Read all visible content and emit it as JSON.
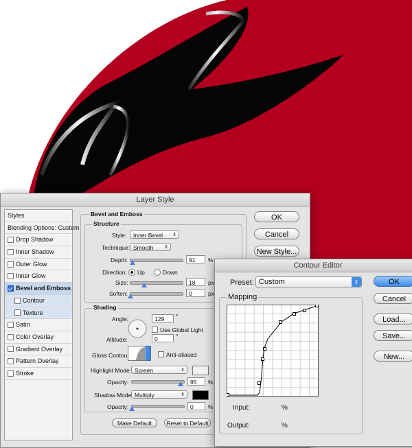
{
  "layer_style": {
    "title": "Layer Style",
    "styles_list": [
      {
        "label": "Styles",
        "checkbox": false,
        "checked": false,
        "kind": "head"
      },
      {
        "label": "Blending Options: Custom",
        "checkbox": false,
        "checked": false,
        "kind": "head"
      },
      {
        "label": "Drop Shadow",
        "checkbox": true,
        "checked": false,
        "kind": "item"
      },
      {
        "label": "Inner Shadow",
        "checkbox": true,
        "checked": false,
        "kind": "item"
      },
      {
        "label": "Outer Glow",
        "checkbox": true,
        "checked": false,
        "kind": "item"
      },
      {
        "label": "Inner Glow",
        "checkbox": true,
        "checked": false,
        "kind": "item"
      },
      {
        "label": "Bevel and Emboss",
        "checkbox": true,
        "checked": true,
        "kind": "sel"
      },
      {
        "label": "Contour",
        "checkbox": true,
        "checked": false,
        "kind": "sub"
      },
      {
        "label": "Texture",
        "checkbox": true,
        "checked": false,
        "kind": "sub"
      },
      {
        "label": "Satin",
        "checkbox": true,
        "checked": false,
        "kind": "item"
      },
      {
        "label": "Color Overlay",
        "checkbox": true,
        "checked": false,
        "kind": "item"
      },
      {
        "label": "Gradient Overlay",
        "checkbox": true,
        "checked": false,
        "kind": "item"
      },
      {
        "label": "Pattern Overlay",
        "checkbox": true,
        "checked": false,
        "kind": "item"
      },
      {
        "label": "Stroke",
        "checkbox": true,
        "checked": false,
        "kind": "item"
      }
    ],
    "bevel": {
      "group_title": "Bevel and Emboss",
      "structure_title": "Structure",
      "style_label": "Style:",
      "style_value": "Inner Bevel",
      "technique_label": "Technique:",
      "technique_value": "Smooth",
      "depth_label": "Depth:",
      "depth_value": "91",
      "depth_unit": "%",
      "direction_label": "Direction:",
      "direction_up": "Up",
      "direction_down": "Down",
      "size_label": "Size:",
      "size_value": "18",
      "size_unit": "px",
      "soften_label": "Soften:",
      "soften_value": "0",
      "soften_unit": "px"
    },
    "shading": {
      "title": "Shading",
      "angle_label": "Angle:",
      "angle_value": "129",
      "angle_unit": "°",
      "global_light_label": "Use Global Light",
      "altitude_label": "Altitude:",
      "altitude_value": "0",
      "altitude_unit": "°",
      "gloss_label": "Gloss Contour:",
      "anti_aliased_label": "Anti-aliased",
      "highlight_label": "Highlight Mode:",
      "highlight_value": "Screen",
      "highlight_color": "#f2f2f2",
      "hl_opacity_label": "Opacity:",
      "hl_opacity_value": "95",
      "hl_opacity_unit": "%",
      "shadow_label": "Shadow Mode:",
      "shadow_value": "Multiply",
      "shadow_color": "#000000",
      "sh_opacity_label": "Opacity:",
      "sh_opacity_value": "0",
      "sh_opacity_unit": "%"
    },
    "make_default": "Make Default",
    "reset_default": "Reset to Default",
    "ok": "OK",
    "cancel": "Cancel",
    "new_style": "New Style..."
  },
  "contour_editor": {
    "title": "Contour Editor",
    "preset_label": "Preset:",
    "preset_value": "Custom",
    "mapping_label": "Mapping",
    "input_label": "Input:",
    "input_unit": "%",
    "output_label": "Output:",
    "output_unit": "%",
    "ok": "OK",
    "cancel": "Cancel",
    "load": "Load...",
    "save": "Save...",
    "new": "New..."
  },
  "colors": {
    "canvas_red": "#b4001f",
    "accent_blue": "#3f8be8"
  }
}
